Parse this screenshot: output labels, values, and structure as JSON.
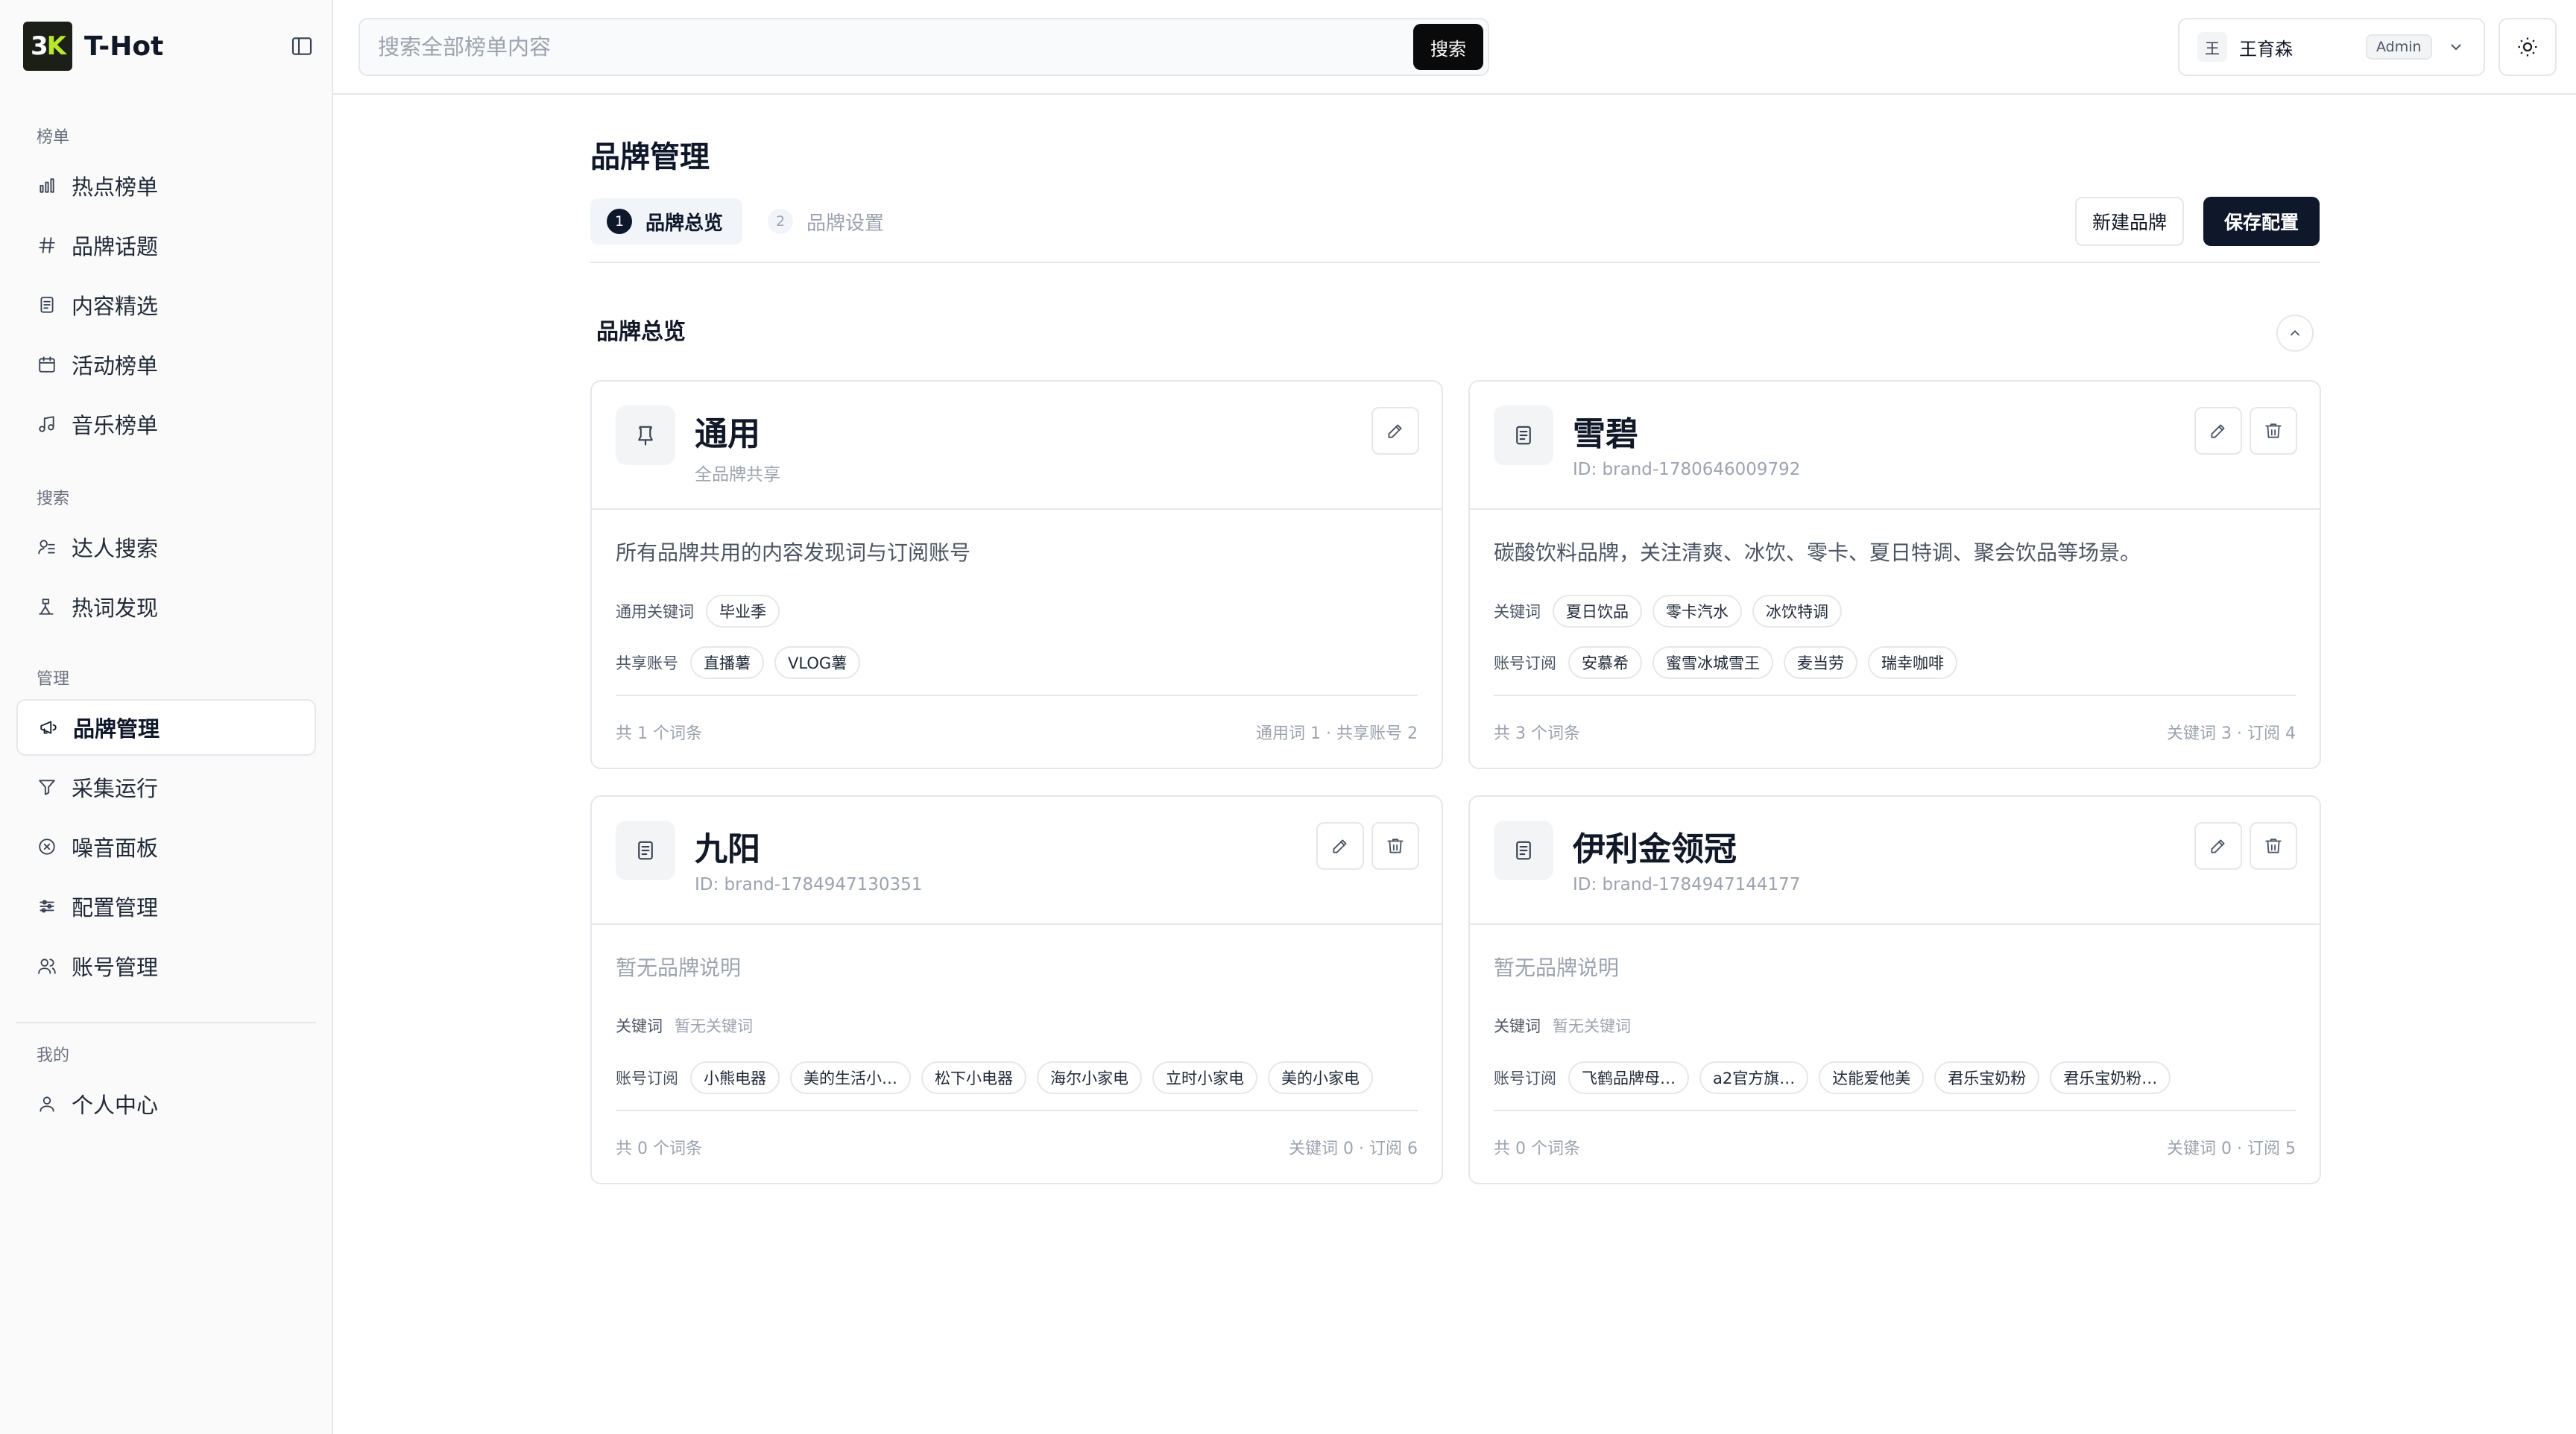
{
  "app": {
    "logo_a": "3",
    "logo_b": "K",
    "name": "T-Hot"
  },
  "sidebar": {
    "groups": [
      {
        "label": "榜单",
        "items": [
          {
            "label": "热点榜单",
            "icon": "chart-bar-icon"
          },
          {
            "label": "品牌话题",
            "icon": "hash-icon"
          },
          {
            "label": "内容精选",
            "icon": "document-icon"
          },
          {
            "label": "活动榜单",
            "icon": "calendar-icon"
          },
          {
            "label": "音乐榜单",
            "icon": "music-icon"
          }
        ]
      },
      {
        "label": "搜索",
        "items": [
          {
            "label": "达人搜索",
            "icon": "user-search-icon"
          },
          {
            "label": "热词发现",
            "icon": "flame-icon"
          }
        ]
      },
      {
        "label": "管理",
        "items": [
          {
            "label": "品牌管理",
            "icon": "megaphone-icon",
            "active": true
          },
          {
            "label": "采集运行",
            "icon": "funnel-icon"
          },
          {
            "label": "噪音面板",
            "icon": "circle-x-icon"
          },
          {
            "label": "配置管理",
            "icon": "sliders-icon"
          },
          {
            "label": "账号管理",
            "icon": "users-icon"
          }
        ]
      },
      {
        "label": "我的",
        "items": [
          {
            "label": "个人中心",
            "icon": "user-icon"
          }
        ]
      }
    ]
  },
  "topbar": {
    "search_placeholder": "搜索全部榜单内容",
    "search_button": "搜索",
    "user_initial": "王",
    "user_name": "王育森",
    "user_role": "Admin"
  },
  "page": {
    "title": "品牌管理",
    "steps": [
      {
        "num": "1",
        "label": "品牌总览",
        "active": true
      },
      {
        "num": "2",
        "label": "品牌设置",
        "active": false
      }
    ],
    "new_brand_label": "新建品牌",
    "save_label": "保存配置",
    "section_title": "品牌总览"
  },
  "cards": [
    {
      "name": "通用",
      "sub": "全品牌共享",
      "icon": "pin-icon",
      "deletable": false,
      "desc": "所有品牌共用的内容发现词与订阅账号",
      "desc_empty": false,
      "row1_label": "通用关键词",
      "row1_tags": [
        "毕业季"
      ],
      "row1_empty": "",
      "row2_label": "共享账号",
      "row2_tags": [
        "直播薯",
        "VLOG薯"
      ],
      "foot_left": "共 1 个词条",
      "foot_right": "通用词 1 · 共享账号 2"
    },
    {
      "name": "雪碧",
      "sub": "ID: brand-1780646009792",
      "icon": "document-icon",
      "deletable": true,
      "desc": "碳酸饮料品牌，关注清爽、冰饮、零卡、夏日特调、聚会饮品等场景。",
      "desc_empty": false,
      "row1_label": "关键词",
      "row1_tags": [
        "夏日饮品",
        "零卡汽水",
        "冰饮特调"
      ],
      "row1_empty": "",
      "row2_label": "账号订阅",
      "row2_tags": [
        "安慕希",
        "蜜雪冰城雪王",
        "麦当劳",
        "瑞幸咖啡"
      ],
      "foot_left": "共 3 个词条",
      "foot_right": "关键词 3 · 订阅 4"
    },
    {
      "name": "九阳",
      "sub": "ID: brand-1784947130351",
      "icon": "document-icon",
      "deletable": true,
      "desc": "暂无品牌说明",
      "desc_empty": true,
      "row1_label": "关键词",
      "row1_tags": [],
      "row1_empty": "暂无关键词",
      "row2_label": "账号订阅",
      "row2_tags": [
        "小熊电器",
        "美的生活小…",
        "松下小电器",
        "海尔小家电",
        "立时小家电",
        "美的小家电"
      ],
      "foot_left": "共 0 个词条",
      "foot_right": "关键词 0 · 订阅 6"
    },
    {
      "name": "伊利金领冠",
      "sub": "ID: brand-1784947144177",
      "icon": "document-icon",
      "deletable": true,
      "desc": "暂无品牌说明",
      "desc_empty": true,
      "row1_label": "关键词",
      "row1_tags": [],
      "row1_empty": "暂无关键词",
      "row2_label": "账号订阅",
      "row2_tags": [
        "飞鹤品牌母…",
        "a2官方旗…",
        "达能爱他美",
        "君乐宝奶粉",
        "君乐宝奶粉…"
      ],
      "foot_left": "共 0 个词条",
      "foot_right": "关键词 0 · 订阅 5"
    }
  ]
}
